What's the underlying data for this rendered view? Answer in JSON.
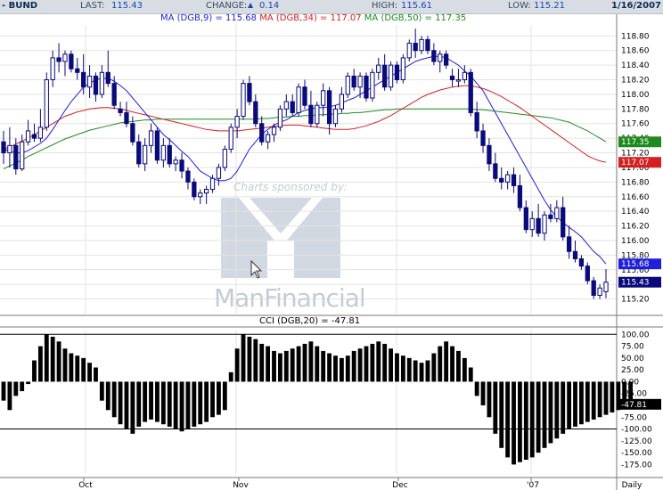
{
  "header": {
    "symbol": "- BUND",
    "last_label": "LAST:",
    "last_value": "115.43",
    "change_label": "CHANGE:",
    "change_value": "0.14",
    "high_label": "HIGH:",
    "high_value": "115.61",
    "low_label": "LOW:",
    "low_value": "115.21",
    "date": "1/16/2007"
  },
  "ma_legend": [
    {
      "text": "MA (DGB,9) = 115.68",
      "color": "#1f1fd8"
    },
    {
      "text": "MA (DGB,34) = 117.07",
      "color": "#d42020"
    },
    {
      "text": "MA (DGB,50) = 117.35",
      "color": "#1d8a1d"
    }
  ],
  "cci_label": "CCI (DGB,20) = -47.81",
  "watermark": {
    "sponsor": "Charts sponsored by:",
    "brand": "ManFinancial"
  },
  "colors": {
    "candle_down": "#0a0a7a",
    "ma9": "#1f1fd8",
    "ma34": "#d42020",
    "ma50": "#1d8a1d",
    "cci_bar": "#000000"
  },
  "chart_data": [
    {
      "type": "candlestick",
      "title": "BUND",
      "ylim": [
        115.0,
        118.95
      ],
      "y_ticks": [
        "118.80",
        "118.60",
        "118.40",
        "118.20",
        "118.00",
        "117.80",
        "117.60",
        "117.40",
        "117.20",
        "117.00",
        "116.80",
        "116.60",
        "116.40",
        "116.20",
        "116.00",
        "115.80",
        "115.60",
        "115.40",
        "115.20"
      ],
      "x_tick_labels": [
        "Oct",
        "Nov",
        "Dec",
        "'07",
        "Daily"
      ],
      "grid": true,
      "price_tags": [
        {
          "value": 117.35,
          "label": "117.35",
          "color": "#1d8a1d"
        },
        {
          "value": 117.07,
          "label": "117.07",
          "color": "#d42020"
        },
        {
          "value": 115.68,
          "label": "115.68",
          "color": "#1f1fd8"
        },
        {
          "value": 115.43,
          "label": "115.43",
          "color": "#0a0a7a"
        }
      ],
      "ohlc": [
        [
          117.35,
          117.5,
          117.05,
          117.2
        ],
        [
          117.2,
          117.55,
          117.0,
          117.3
        ],
        [
          117.3,
          117.4,
          116.9,
          116.98
        ],
        [
          116.98,
          117.45,
          116.95,
          117.35
        ],
        [
          117.35,
          117.65,
          117.3,
          117.5
        ],
        [
          117.45,
          117.6,
          117.35,
          117.4
        ],
        [
          117.4,
          117.8,
          117.35,
          117.55
        ],
        [
          117.55,
          118.3,
          117.5,
          118.2
        ],
        [
          118.2,
          118.6,
          118.1,
          118.5
        ],
        [
          118.5,
          118.7,
          118.3,
          118.45
        ],
        [
          118.45,
          118.6,
          118.25,
          118.55
        ],
        [
          118.55,
          118.6,
          118.3,
          118.35
        ],
        [
          118.35,
          118.5,
          118.2,
          118.3
        ],
        [
          118.3,
          118.55,
          118.0,
          118.1
        ],
        [
          118.1,
          118.4,
          117.95,
          118.25
        ],
        [
          118.25,
          118.3,
          117.9,
          118.0
        ],
        [
          118.0,
          118.4,
          117.95,
          118.3
        ],
        [
          118.3,
          118.6,
          118.1,
          118.15
        ],
        [
          118.15,
          118.25,
          117.8,
          117.85
        ],
        [
          117.8,
          117.9,
          117.7,
          117.75
        ],
        [
          117.75,
          117.9,
          117.55,
          117.6
        ],
        [
          117.6,
          117.7,
          117.3,
          117.35
        ],
        [
          117.35,
          117.45,
          117.0,
          117.05
        ],
        [
          117.05,
          117.4,
          116.95,
          117.3
        ],
        [
          117.3,
          117.6,
          117.2,
          117.5
        ],
        [
          117.5,
          117.55,
          117.05,
          117.1
        ],
        [
          117.1,
          117.4,
          117.0,
          117.3
        ],
        [
          117.3,
          117.4,
          117.0,
          117.05
        ],
        [
          117.05,
          117.15,
          116.95,
          117.1
        ],
        [
          117.1,
          117.2,
          116.85,
          116.95
        ],
        [
          116.95,
          117.0,
          116.7,
          116.8
        ],
        [
          116.8,
          116.85,
          116.55,
          116.6
        ],
        [
          116.6,
          116.7,
          116.5,
          116.65
        ],
        [
          116.65,
          116.75,
          116.5,
          116.7
        ],
        [
          116.7,
          116.9,
          116.65,
          116.85
        ],
        [
          116.85,
          117.05,
          116.75,
          117.0
        ],
        [
          117.0,
          117.3,
          116.95,
          117.25
        ],
        [
          117.25,
          117.6,
          117.2,
          117.55
        ],
        [
          117.55,
          117.8,
          117.4,
          117.7
        ],
        [
          117.7,
          118.2,
          117.65,
          118.15
        ],
        [
          118.15,
          118.25,
          117.85,
          117.9
        ],
        [
          117.9,
          118.0,
          117.55,
          117.6
        ],
        [
          117.6,
          117.7,
          117.3,
          117.35
        ],
        [
          117.35,
          117.5,
          117.25,
          117.45
        ],
        [
          117.45,
          117.6,
          117.35,
          117.55
        ],
        [
          117.55,
          117.85,
          117.5,
          117.8
        ],
        [
          117.8,
          118.0,
          117.7,
          117.9
        ],
        [
          117.9,
          118.0,
          117.7,
          117.75
        ],
        [
          117.75,
          118.15,
          117.7,
          118.1
        ],
        [
          118.1,
          118.2,
          117.8,
          117.85
        ],
        [
          117.85,
          118.05,
          117.55,
          117.6
        ],
        [
          117.6,
          117.9,
          117.55,
          117.85
        ],
        [
          117.85,
          118.15,
          117.7,
          118.05
        ],
        [
          118.05,
          118.1,
          117.45,
          117.6
        ],
        [
          117.6,
          117.85,
          117.55,
          117.8
        ],
        [
          117.8,
          118.1,
          117.75,
          118.0
        ],
        [
          118.0,
          118.3,
          117.95,
          118.25
        ],
        [
          118.25,
          118.35,
          118.05,
          118.1
        ],
        [
          118.1,
          118.3,
          117.95,
          118.25
        ],
        [
          118.25,
          118.3,
          117.9,
          117.95
        ],
        [
          117.95,
          118.35,
          117.9,
          118.3
        ],
        [
          118.3,
          118.5,
          118.2,
          118.4
        ],
        [
          118.4,
          118.55,
          118.05,
          118.1
        ],
        [
          118.1,
          118.45,
          118.05,
          118.4
        ],
        [
          118.4,
          118.45,
          118.15,
          118.2
        ],
        [
          118.2,
          118.55,
          118.15,
          118.5
        ],
        [
          118.5,
          118.75,
          118.45,
          118.7
        ],
        [
          118.7,
          118.9,
          118.5,
          118.6
        ],
        [
          118.6,
          118.8,
          118.55,
          118.75
        ],
        [
          118.75,
          118.8,
          118.55,
          118.6
        ],
        [
          118.6,
          118.7,
          118.4,
          118.45
        ],
        [
          118.45,
          118.6,
          118.3,
          118.55
        ],
        [
          118.55,
          118.6,
          118.35,
          118.4
        ],
        [
          118.25,
          118.35,
          118.1,
          118.2
        ],
        [
          118.2,
          118.35,
          118.1,
          118.2
        ],
        [
          118.2,
          118.4,
          118.15,
          118.3
        ],
        [
          118.3,
          118.35,
          117.7,
          117.75
        ],
        [
          117.75,
          117.9,
          117.4,
          117.5
        ],
        [
          117.5,
          117.6,
          117.2,
          117.3
        ],
        [
          117.3,
          117.4,
          116.95,
          117.05
        ],
        [
          117.05,
          117.2,
          116.8,
          116.85
        ],
        [
          116.85,
          117.0,
          116.7,
          116.8
        ],
        [
          116.8,
          116.95,
          116.7,
          116.9
        ],
        [
          116.9,
          117.0,
          116.65,
          116.75
        ],
        [
          116.75,
          116.9,
          116.4,
          116.45
        ],
        [
          116.45,
          116.55,
          116.1,
          116.15
        ],
        [
          116.15,
          116.4,
          116.05,
          116.3
        ],
        [
          116.3,
          116.5,
          116.05,
          116.1
        ],
        [
          116.1,
          116.4,
          116.0,
          116.35
        ],
        [
          116.35,
          116.5,
          116.25,
          116.3
        ],
        [
          116.3,
          116.55,
          116.25,
          116.45
        ],
        [
          116.45,
          116.6,
          116.0,
          116.05
        ],
        [
          116.05,
          116.2,
          115.75,
          115.85
        ],
        [
          115.85,
          116.0,
          115.7,
          115.75
        ],
        [
          115.75,
          115.8,
          115.6,
          115.65
        ],
        [
          115.65,
          115.7,
          115.4,
          115.45
        ],
        [
          115.45,
          115.5,
          115.2,
          115.25
        ],
        [
          115.25,
          115.4,
          115.2,
          115.35
        ],
        [
          115.3,
          115.61,
          115.21,
          115.43
        ]
      ],
      "ma9": [
        117.25,
        117.22,
        117.2,
        117.2,
        117.23,
        117.28,
        117.33,
        117.4,
        117.52,
        117.65,
        117.78,
        117.9,
        118.0,
        118.1,
        118.15,
        118.2,
        118.22,
        118.22,
        118.18,
        118.12,
        118.05,
        117.95,
        117.85,
        117.75,
        117.65,
        117.55,
        117.45,
        117.38,
        117.3,
        117.22,
        117.15,
        117.05,
        116.95,
        116.9,
        116.85,
        116.82,
        116.82,
        116.85,
        116.95,
        117.1,
        117.25,
        117.35,
        117.45,
        117.52,
        117.58,
        117.62,
        117.65,
        117.7,
        117.75,
        117.78,
        117.8,
        117.82,
        117.82,
        117.83,
        117.85,
        117.88,
        117.92,
        117.95,
        118.0,
        118.05,
        118.1,
        118.15,
        118.2,
        118.25,
        118.3,
        118.35,
        118.4,
        118.45,
        118.48,
        118.5,
        118.52,
        118.52,
        118.5,
        118.45,
        118.4,
        118.32,
        118.25,
        118.15,
        118.05,
        117.9,
        117.75,
        117.6,
        117.45,
        117.3,
        117.15,
        117.0,
        116.85,
        116.7,
        116.55,
        116.42,
        116.32,
        116.25,
        116.18,
        116.12,
        116.05,
        115.95,
        115.85,
        115.78,
        115.68
      ],
      "ma34": [
        117.25,
        117.28,
        117.32,
        117.36,
        117.4,
        117.45,
        117.5,
        117.55,
        117.6,
        117.65,
        117.7,
        117.73,
        117.76,
        117.78,
        117.8,
        117.81,
        117.82,
        117.82,
        117.81,
        117.8,
        117.78,
        117.76,
        117.74,
        117.72,
        117.7,
        117.68,
        117.66,
        117.64,
        117.62,
        117.6,
        117.58,
        117.56,
        117.54,
        117.52,
        117.51,
        117.5,
        117.5,
        117.5,
        117.5,
        117.51,
        117.52,
        117.53,
        117.54,
        117.55,
        117.56,
        117.57,
        117.58,
        117.58,
        117.58,
        117.57,
        117.56,
        117.55,
        117.54,
        117.53,
        117.52,
        117.52,
        117.52,
        117.53,
        117.55,
        117.57,
        117.6,
        117.63,
        117.67,
        117.71,
        117.76,
        117.81,
        117.86,
        117.91,
        117.96,
        118.0,
        118.03,
        118.06,
        118.08,
        118.1,
        118.11,
        118.12,
        118.12,
        118.1,
        118.08,
        118.05,
        118.01,
        117.97,
        117.92,
        117.87,
        117.82,
        117.76,
        117.7,
        117.64,
        117.58,
        117.52,
        117.46,
        117.4,
        117.34,
        117.28,
        117.22,
        117.16,
        117.12,
        117.09,
        117.07
      ],
      "ma50": [
        116.98,
        117.02,
        117.06,
        117.1,
        117.15,
        117.19,
        117.23,
        117.27,
        117.31,
        117.35,
        117.39,
        117.42,
        117.45,
        117.48,
        117.51,
        117.53,
        117.55,
        117.57,
        117.59,
        117.61,
        117.62,
        117.63,
        117.64,
        117.65,
        117.65,
        117.66,
        117.66,
        117.66,
        117.66,
        117.66,
        117.66,
        117.66,
        117.66,
        117.66,
        117.66,
        117.66,
        117.66,
        117.66,
        117.66,
        117.66,
        117.66,
        117.66,
        117.67,
        117.67,
        117.68,
        117.69,
        117.69,
        117.7,
        117.7,
        117.71,
        117.71,
        117.72,
        117.72,
        117.73,
        117.73,
        117.74,
        117.74,
        117.75,
        117.75,
        117.76,
        117.77,
        117.78,
        117.79,
        117.79,
        117.8,
        117.8,
        117.8,
        117.8,
        117.8,
        117.8,
        117.8,
        117.8,
        117.8,
        117.8,
        117.8,
        117.8,
        117.8,
        117.79,
        117.79,
        117.78,
        117.77,
        117.76,
        117.75,
        117.74,
        117.73,
        117.72,
        117.71,
        117.7,
        117.69,
        117.68,
        117.66,
        117.64,
        117.62,
        117.58,
        117.54,
        117.5,
        117.45,
        117.4,
        117.35
      ]
    },
    {
      "type": "bar",
      "title": "CCI (DGB,20)",
      "ylim": [
        -195,
        110
      ],
      "y_ticks": [
        "100.00",
        "75.00",
        "50.00",
        "25.00",
        "0.00",
        "-25.00",
        "-50.00",
        "-75.00",
        "-100.00",
        "-125.00",
        "-150.00",
        "-175.00"
      ],
      "reference_lines": [
        100,
        -100
      ],
      "latest_tag": {
        "value": -47.81,
        "label": "-47.81"
      },
      "values": [
        -40,
        -60,
        -30,
        -20,
        -5,
        45,
        75,
        100,
        95,
        85,
        70,
        60,
        55,
        50,
        40,
        30,
        -40,
        -60,
        -75,
        -90,
        -100,
        -110,
        -95,
        -85,
        -80,
        -85,
        -90,
        -95,
        -100,
        -105,
        -100,
        -95,
        -90,
        -85,
        -75,
        -70,
        -60,
        20,
        70,
        100,
        95,
        90,
        80,
        75,
        65,
        60,
        65,
        70,
        75,
        80,
        85,
        75,
        65,
        60,
        55,
        50,
        55,
        65,
        70,
        75,
        80,
        85,
        80,
        70,
        60,
        55,
        50,
        45,
        40,
        45,
        60,
        75,
        85,
        75,
        65,
        50,
        30,
        -30,
        -50,
        -75,
        -110,
        -140,
        -160,
        -175,
        -170,
        -165,
        -160,
        -150,
        -140,
        -130,
        -120,
        -110,
        -100,
        -95,
        -90,
        -85,
        -80,
        -75,
        -70,
        -65,
        -60,
        -55,
        -48
      ]
    }
  ]
}
